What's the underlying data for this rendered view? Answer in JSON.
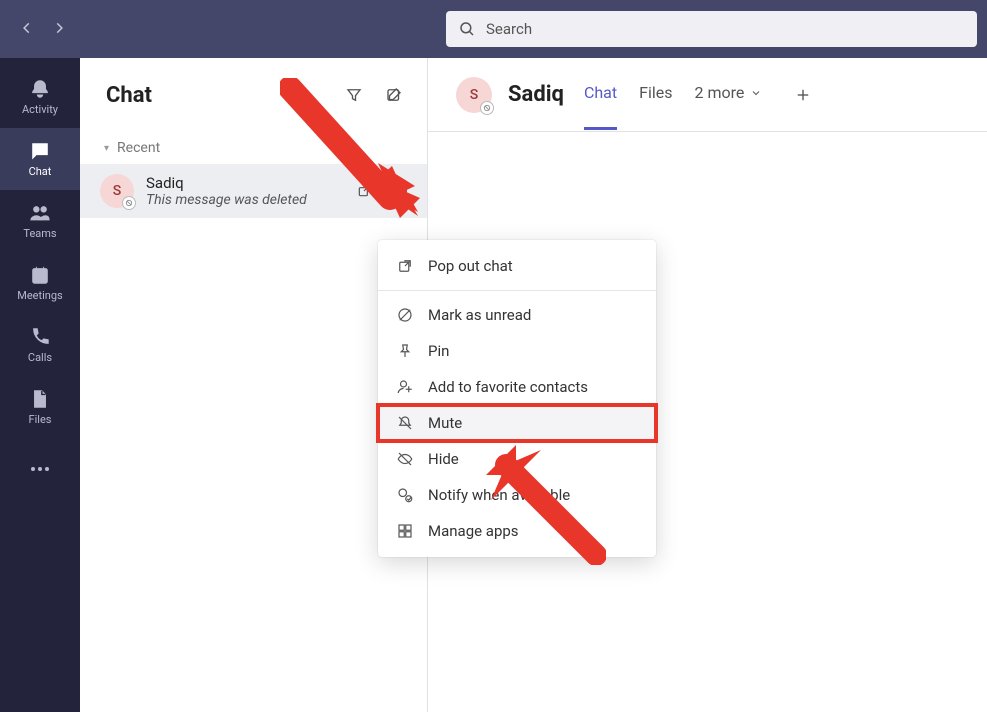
{
  "titlebar": {
    "search_placeholder": "Search"
  },
  "apprail": {
    "items": [
      {
        "name": "activity",
        "label": "Activity"
      },
      {
        "name": "chat",
        "label": "Chat",
        "active": true
      },
      {
        "name": "teams",
        "label": "Teams"
      },
      {
        "name": "meetings",
        "label": "Meetings"
      },
      {
        "name": "calls",
        "label": "Calls"
      },
      {
        "name": "files",
        "label": "Files"
      }
    ]
  },
  "chatlist": {
    "title": "Chat",
    "recent_label": "Recent",
    "items": [
      {
        "initial": "S",
        "name": "Sadiq",
        "preview": "This message was deleted",
        "selected": true,
        "presence": "offline"
      }
    ]
  },
  "content": {
    "contact_initial": "S",
    "contact_name": "Sadiq",
    "tabs": {
      "chat": "Chat",
      "files": "Files",
      "more_label": "2 more"
    }
  },
  "context_menu": {
    "items": [
      {
        "icon": "popout",
        "label": "Pop out chat"
      },
      {
        "icon": "sep"
      },
      {
        "icon": "mark-unread",
        "label": "Mark as unread"
      },
      {
        "icon": "pin",
        "label": "Pin"
      },
      {
        "icon": "add-favorite",
        "label": "Add to favorite contacts"
      },
      {
        "icon": "mute",
        "label": "Mute",
        "highlight": true
      },
      {
        "icon": "hide",
        "label": "Hide"
      },
      {
        "icon": "notify",
        "label": "Notify when available"
      },
      {
        "icon": "manage-apps",
        "label": "Manage apps"
      }
    ]
  },
  "colors": {
    "brand": "#5558c9",
    "titlebar": "#44476a",
    "rail": "#23233c",
    "annotation": "#e8362b"
  }
}
